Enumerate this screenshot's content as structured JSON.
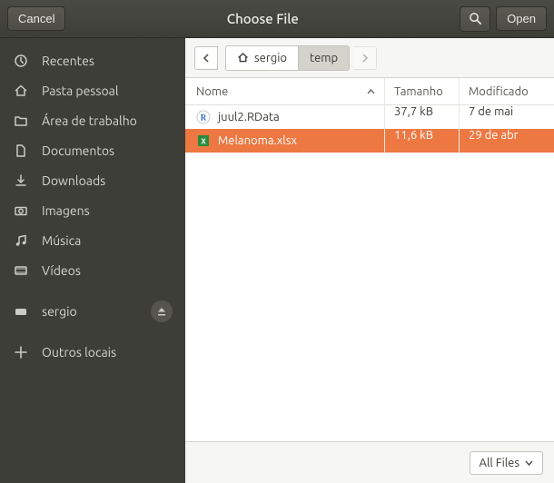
{
  "titlebar": {
    "cancel": "Cancel",
    "title": "Choose File",
    "open": "Open"
  },
  "sidebar": {
    "items": [
      {
        "icon": "clock",
        "label": "Recentes"
      },
      {
        "icon": "home",
        "label": "Pasta pessoal"
      },
      {
        "icon": "folder",
        "label": "Área de trabalho"
      },
      {
        "icon": "document",
        "label": "Documentos"
      },
      {
        "icon": "download",
        "label": "Downloads"
      },
      {
        "icon": "camera",
        "label": "Imagens"
      },
      {
        "icon": "music",
        "label": "Música"
      },
      {
        "icon": "video",
        "label": "Vídeos"
      }
    ],
    "volumes": [
      {
        "icon": "disk",
        "label": "sergio",
        "ejectable": true
      }
    ],
    "other": {
      "icon": "plus",
      "label": "Outros locais"
    }
  },
  "path": {
    "segments": [
      {
        "label": "sergio",
        "home": true,
        "active": false
      },
      {
        "label": "temp",
        "home": false,
        "active": true
      }
    ]
  },
  "columns": {
    "name": "Nome",
    "size": "Tamanho",
    "modified": "Modificado"
  },
  "files": [
    {
      "icon": "rdata",
      "name": "juul2.RData",
      "size": "37,7 kB",
      "modified": "7 de mai",
      "selected": false
    },
    {
      "icon": "xlsx",
      "name": "Melanoma.xlsx",
      "size": "11,6 kB",
      "modified": "29 de abr",
      "selected": true
    }
  ],
  "filter": {
    "label": "All Files"
  }
}
